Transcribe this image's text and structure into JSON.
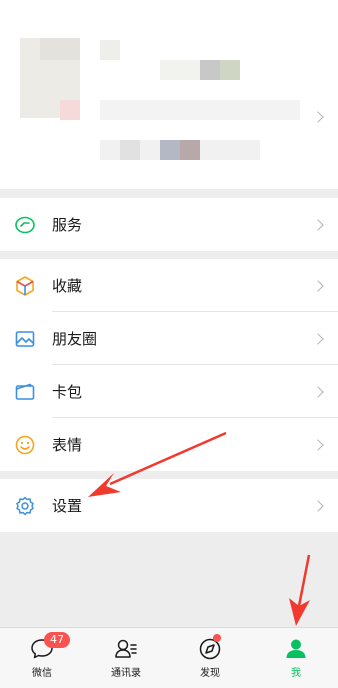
{
  "menu": {
    "service": {
      "label": "服务",
      "icon": "service-icon"
    },
    "favorites": {
      "label": "收藏",
      "icon": "favorites-cube-icon"
    },
    "moments": {
      "label": "朋友圈",
      "icon": "moments-image-icon"
    },
    "card_wallet": {
      "label": "卡包",
      "icon": "card-wallet-icon"
    },
    "stickers": {
      "label": "表情",
      "icon": "smiley-icon"
    },
    "settings": {
      "label": "设置",
      "icon": "gear-icon"
    }
  },
  "tabbar": {
    "chats": {
      "label": "微信",
      "badge": "47"
    },
    "contacts": {
      "label": "通讯录"
    },
    "discover": {
      "label": "发现"
    },
    "me": {
      "label": "我"
    }
  },
  "colors": {
    "accent_green": "#07c160",
    "badge_red": "#fa5151",
    "annotation_red": "#f03a2f"
  }
}
